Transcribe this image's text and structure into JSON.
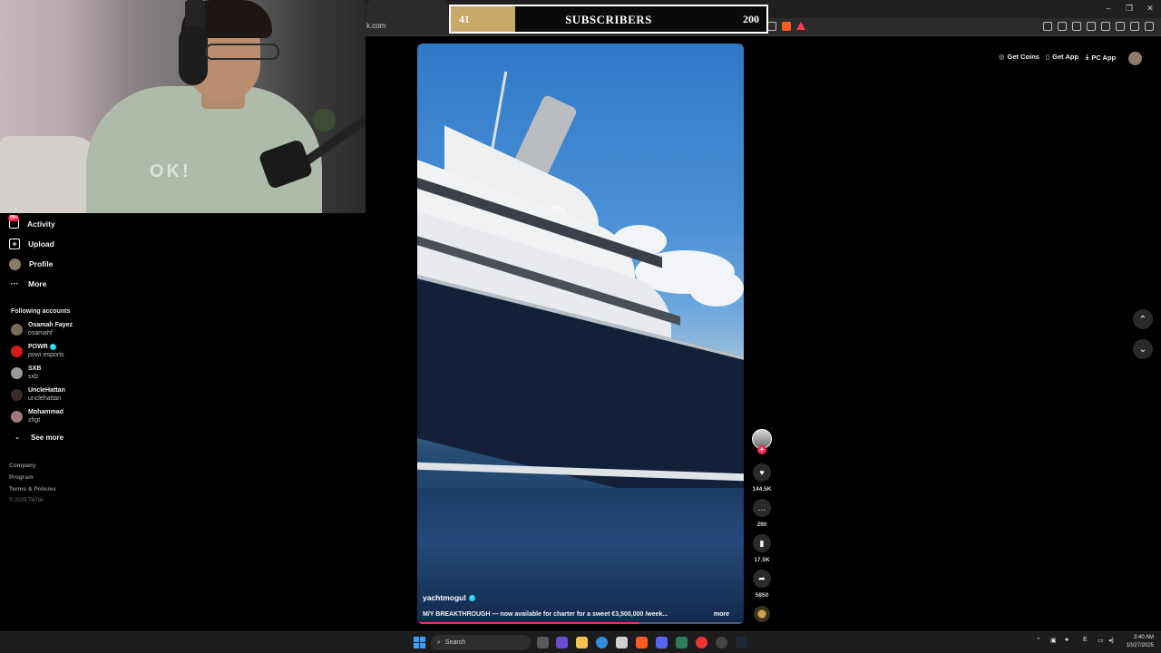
{
  "browser": {
    "url_fragment": "k.com",
    "window_controls": [
      "–",
      "❐",
      "✕"
    ]
  },
  "subscriber_goal": {
    "current": "41",
    "current_value": 41,
    "label": "SUBSCRIBERS",
    "goal": "200",
    "goal_value": 200,
    "fill_color": "#c9a96a"
  },
  "sidebar": {
    "nav": [
      {
        "label": "Activity",
        "icon": "inbox-icon",
        "badge": "99+"
      },
      {
        "label": "Upload",
        "icon": "plus-square-icon"
      },
      {
        "label": "Profile",
        "icon": "profile-avatar"
      },
      {
        "label": "More",
        "icon": "more-dots-icon"
      }
    ],
    "following_title": "Following accounts",
    "accounts": [
      {
        "name": "Osamah Fayez",
        "handle": "osamahf",
        "verified": false,
        "color": "#7a6a5a"
      },
      {
        "name": "POWR",
        "handle": "powr.esports",
        "verified": true,
        "color": "#d11a1a"
      },
      {
        "name": "SXB",
        "handle": "sxb",
        "verified": false,
        "color": "#9a9a9a"
      },
      {
        "name": "UncleHattan",
        "handle": "unclehattan",
        "verified": false,
        "color": "#3a2a2a"
      },
      {
        "name": "Mohammad",
        "handle": "zhgt",
        "verified": false,
        "color": "#a07a7a"
      }
    ],
    "see_more": "See more",
    "footer_links": [
      "Company",
      "Program",
      "Terms & Policies"
    ],
    "copyright": "© 2025 TikTok"
  },
  "video": {
    "author": "yachtmogul",
    "author_verified": true,
    "caption": "M/Y BREAKTHROUGH — now available for charter for a sweet €3,500,000 /week...",
    "more": "more",
    "progress_fraction": 0.68,
    "progress_color": "#fe2c55"
  },
  "actions": {
    "likes": "144.5K",
    "comments": "290",
    "saves": "17.5K",
    "shares": "5850"
  },
  "top_actions": {
    "get_coins": "Get Coins",
    "get_app": "Get App",
    "pc_app": "PC App"
  },
  "taskbar": {
    "search_placeholder": "Search",
    "time": "3:40 AM",
    "date": "10/27/2025",
    "language": "E"
  }
}
